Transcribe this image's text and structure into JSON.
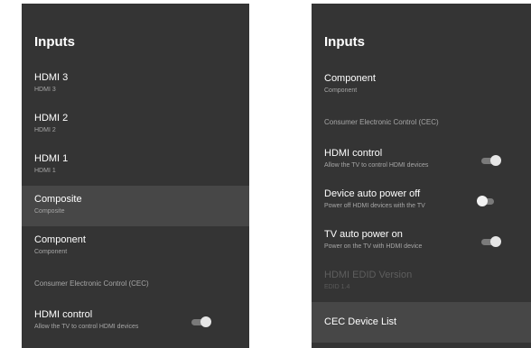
{
  "left": {
    "title": "Inputs",
    "items": [
      {
        "label": "HDMI 3",
        "sub": "HDMI 3"
      },
      {
        "label": "HDMI 2",
        "sub": "HDMI 2"
      },
      {
        "label": "HDMI 1",
        "sub": "HDMI 1"
      },
      {
        "label": "Composite",
        "sub": "Composite"
      },
      {
        "label": "Component",
        "sub": "Component"
      }
    ],
    "section": "Consumer Electronic Control (CEC)",
    "hdmi_control": {
      "label": "HDMI control",
      "sub": "Allow the TV to control HDMI devices",
      "state": "on"
    }
  },
  "right": {
    "title": "Inputs",
    "component": {
      "label": "Component",
      "sub": "Component"
    },
    "section": "Consumer Electronic Control (CEC)",
    "hdmi_control": {
      "label": "HDMI control",
      "sub": "Allow the TV to control HDMI devices",
      "state": "on"
    },
    "device_auto_power_off": {
      "label": "Device auto power off",
      "sub": "Power off HDMI devices with the TV",
      "state": "off"
    },
    "tv_auto_power_on": {
      "label": "TV auto power on",
      "sub": "Power on the TV with HDMI device",
      "state": "on"
    },
    "edid": {
      "label": "HDMI EDID Version",
      "sub": "EDID 1.4"
    },
    "cec_device_list": {
      "label": "CEC Device List"
    }
  },
  "colors": {
    "panel_bg": "#343434",
    "selected_bg": "#474747",
    "subtext": "#a6a6a6"
  }
}
